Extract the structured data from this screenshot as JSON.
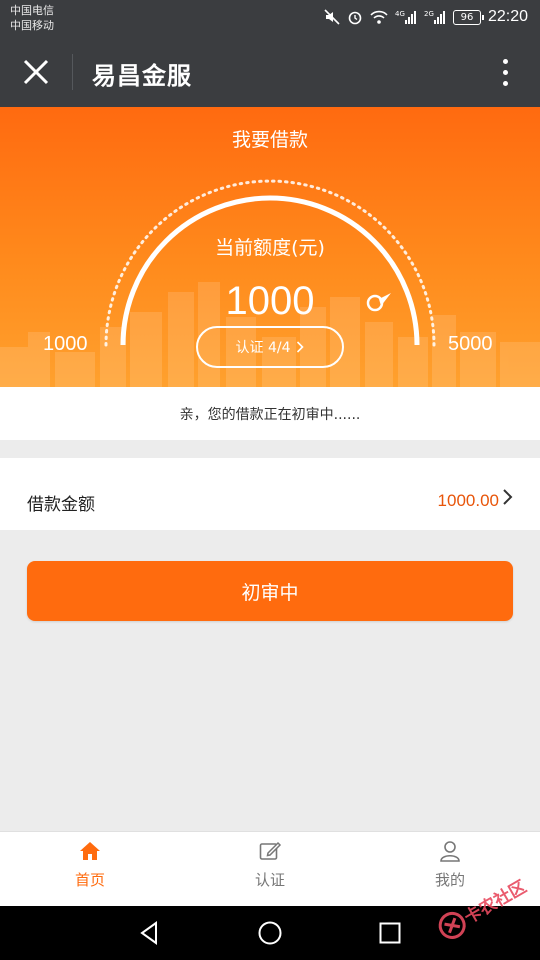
{
  "status_bar": {
    "carrier_1": "中国电信",
    "carrier_2": "中国移动",
    "battery": "96",
    "time": "22:20",
    "network_1": "4G",
    "network_2": "2G"
  },
  "app_bar": {
    "title": "易昌金服"
  },
  "hero": {
    "title": "我要借款",
    "gauge_label": "当前额度(元)",
    "current_amount": "1000",
    "min_amount": "1000",
    "max_amount": "5000",
    "auth_label": "认证 4/4",
    "accent_color": "#ff6b0e"
  },
  "notice": {
    "text": "亲，您的借款正在初审中......"
  },
  "loan": {
    "label": "借款金额",
    "value": "1000.00"
  },
  "status_button": {
    "label": "初审中"
  },
  "tabs": [
    {
      "label": "首页",
      "icon": "home-icon",
      "active": true
    },
    {
      "label": "认证",
      "icon": "edit-icon",
      "active": false
    },
    {
      "label": "我的",
      "icon": "user-icon",
      "active": false
    }
  ],
  "watermark": {
    "text": "卡农社区"
  }
}
